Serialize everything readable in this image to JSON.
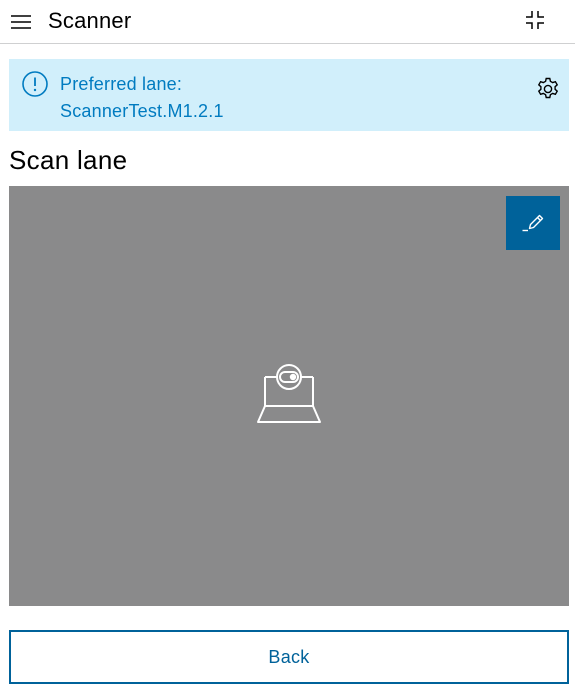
{
  "header": {
    "title": "Scanner",
    "menu_icon": "hamburger-menu-icon",
    "collapse_icon": "collapse-icon"
  },
  "notice": {
    "label": "Preferred lane:",
    "value": "ScannerTest.M1.2.1",
    "icon": "info-exclamation-icon",
    "settings_icon": "gear-icon"
  },
  "scan": {
    "title": "Scan lane",
    "edit_icon": "pencil-edit-icon",
    "camera_icon": "webcam-icon"
  },
  "footer": {
    "back_label": "Back"
  },
  "colors": {
    "accent": "#00629a",
    "notice_bg": "#d1effb",
    "notice_text": "#007bc0",
    "camera_bg": "#8a8a8b"
  }
}
